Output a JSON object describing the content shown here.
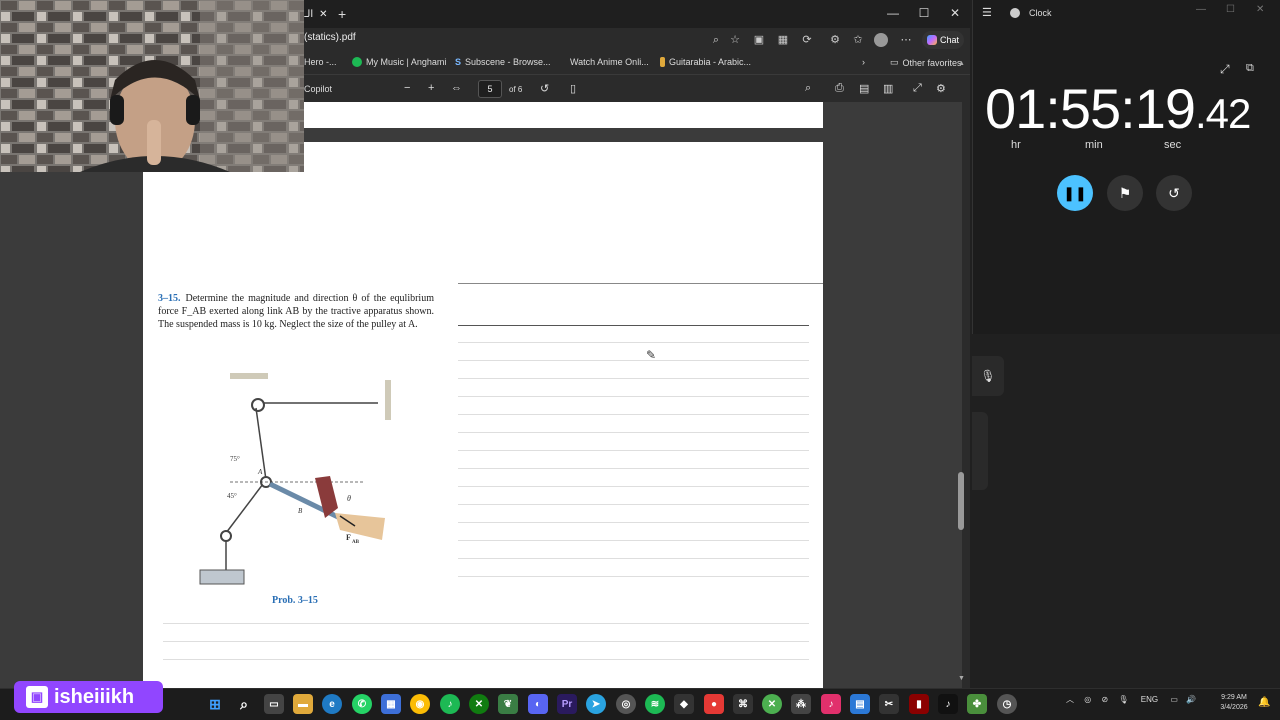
{
  "browser": {
    "tab_title": "...الـ",
    "url": "(statics).pdf",
    "chat_label": "Chat",
    "favorites": [
      "Hero -...",
      "My Music | Anghami",
      "Subscene - Browse...",
      "Watch Anime Onli...",
      "Guitarabia - Arabic..."
    ],
    "other_favorites": "Other favorites",
    "pdf": {
      "sidebar_label": "Copilot",
      "page_number": "5",
      "page_total": "of 6"
    }
  },
  "document": {
    "problem_number": "3–15.",
    "problem_text": "Determine the magnitude and direction θ of the equlibrium force F_AB exerted along link AB by the tractive apparatus shown. The suspended mass is 10 kg. Neglect the size of the pulley at A.",
    "caption": "Prob. 3–15",
    "figure_labels": {
      "angle1": "75°",
      "angle2": "45°",
      "point_a": "A",
      "point_b": "B",
      "theta": "θ",
      "force": "F",
      "force_sub": "AB"
    }
  },
  "clock": {
    "app_title": "Clock",
    "time_main": "01:55:19",
    "time_frac": ".42",
    "units": [
      "hr",
      "min",
      "sec"
    ]
  },
  "taskbar": {
    "lang": "ENG",
    "time": "9:29 AM",
    "date": "3/4/2026"
  },
  "overlay": {
    "channel": "isheiiikh"
  },
  "colors": {
    "accent": "#4cc2ff",
    "twitch": "#9146ff",
    "problem_blue": "#2a6fb5"
  }
}
